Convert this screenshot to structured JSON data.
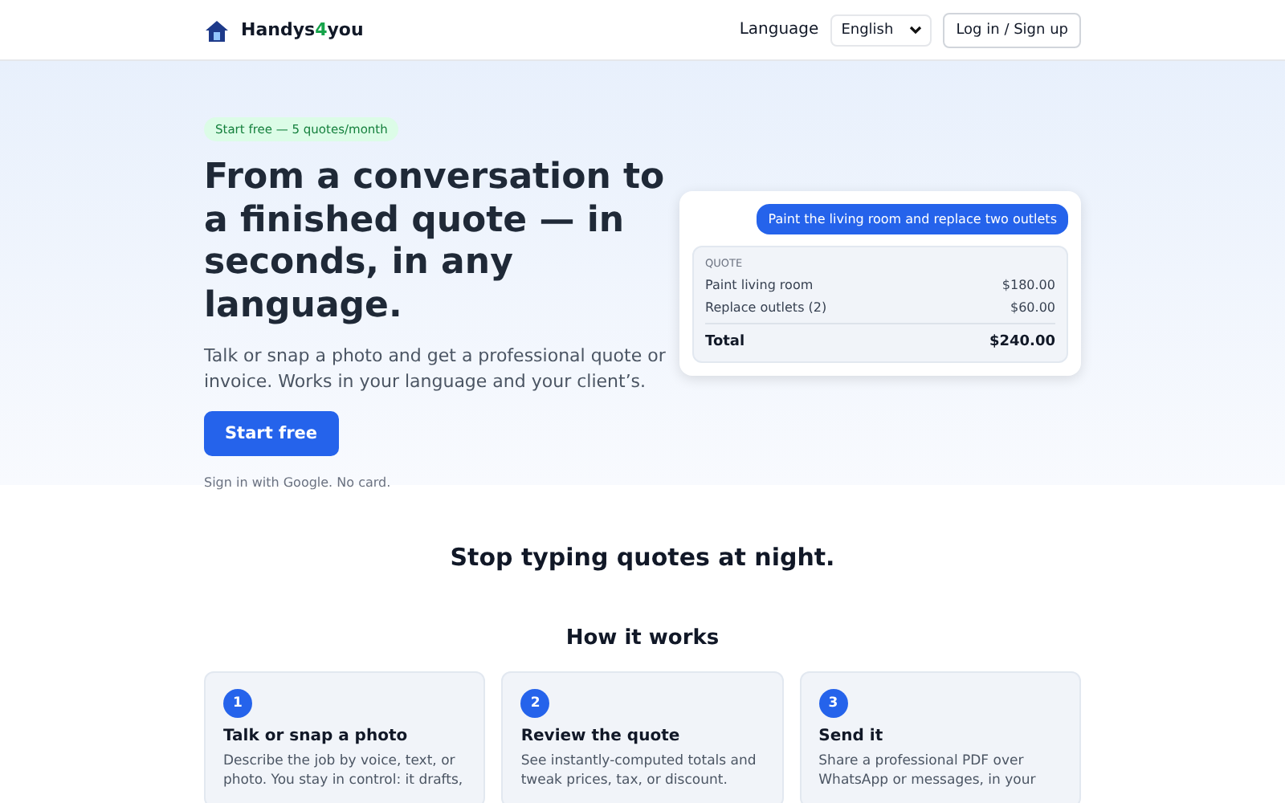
{
  "header": {
    "brand": {
      "before": "Handys",
      "accent": "4",
      "after": "you"
    },
    "language_label": "Language",
    "language_value": "English",
    "login_button": "Log in / Sign up"
  },
  "hero": {
    "badge": "Start free — 5 quotes/month",
    "title": "From a conversation to a finished quote — in seconds, in any language.",
    "subtitle": "Talk or snap a photo and get a professional quote or invoice. Works in your language and your client’s.",
    "cta": "Start free",
    "note": "Sign in with Google. No card."
  },
  "demo": {
    "message": "Paint the living room and replace two outlets",
    "quote_label": "QUOTE",
    "lines": [
      {
        "item": "Paint living room",
        "amount": "$180.00"
      },
      {
        "item": "Replace outlets (2)",
        "amount": "$60.00"
      }
    ],
    "total_label": "Total",
    "total_amount": "$240.00"
  },
  "tagline": "Stop typing quotes at night.",
  "how": {
    "title": "How it works",
    "steps": [
      {
        "number": "1",
        "title": "Talk or snap a photo",
        "text": "Describe the job by voice, text, or photo. You stay in control: it drafts,"
      },
      {
        "number": "2",
        "title": "Review the quote",
        "text": "See instantly-computed totals and tweak prices, tax, or discount."
      },
      {
        "number": "3",
        "title": "Send it",
        "text": "Share a professional PDF over WhatsApp or messages, in your"
      }
    ]
  }
}
